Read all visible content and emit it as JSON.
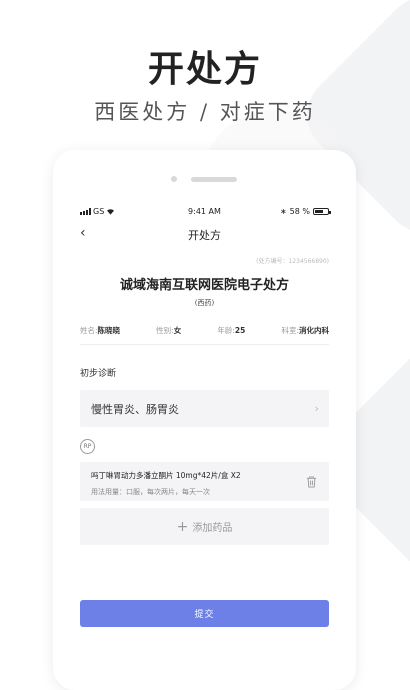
{
  "hero": {
    "title": "开处方",
    "subtitle": "西医处方 / 对症下药"
  },
  "status_bar": {
    "carrier": "GS",
    "time": "9:41 AM",
    "bluetooth": "∗",
    "battery": "58 %"
  },
  "nav": {
    "back_glyph": "‹",
    "title": "开处方"
  },
  "prescription": {
    "number_label": "(处方编号：1234566890)",
    "hospital_title": "诚域海南互联网医院电子处方",
    "type_label": "(西药)"
  },
  "patient": {
    "name_label": "姓名:",
    "name": "陈晓晓",
    "gender_label": "性别:",
    "gender": "女",
    "age_label": "年龄:",
    "age": "25",
    "dept_label": "科室:",
    "dept": "消化内科"
  },
  "diagnosis": {
    "section_label": "初步诊断",
    "value": "慢性胃炎、肠胃炎",
    "chevron": "›"
  },
  "rp": {
    "label": "RP"
  },
  "drug": {
    "name": "吗丁啉胃动力多潘立酮片  10mg*42片/盒  X2",
    "usage": "用法用量：口服，每次两片，每天一次"
  },
  "add_drug": {
    "plus": "+",
    "label": "添加药品"
  },
  "submit": {
    "label": "提交"
  },
  "colors": {
    "accent": "#6c80e8",
    "field_bg": "#f4f4f6"
  }
}
